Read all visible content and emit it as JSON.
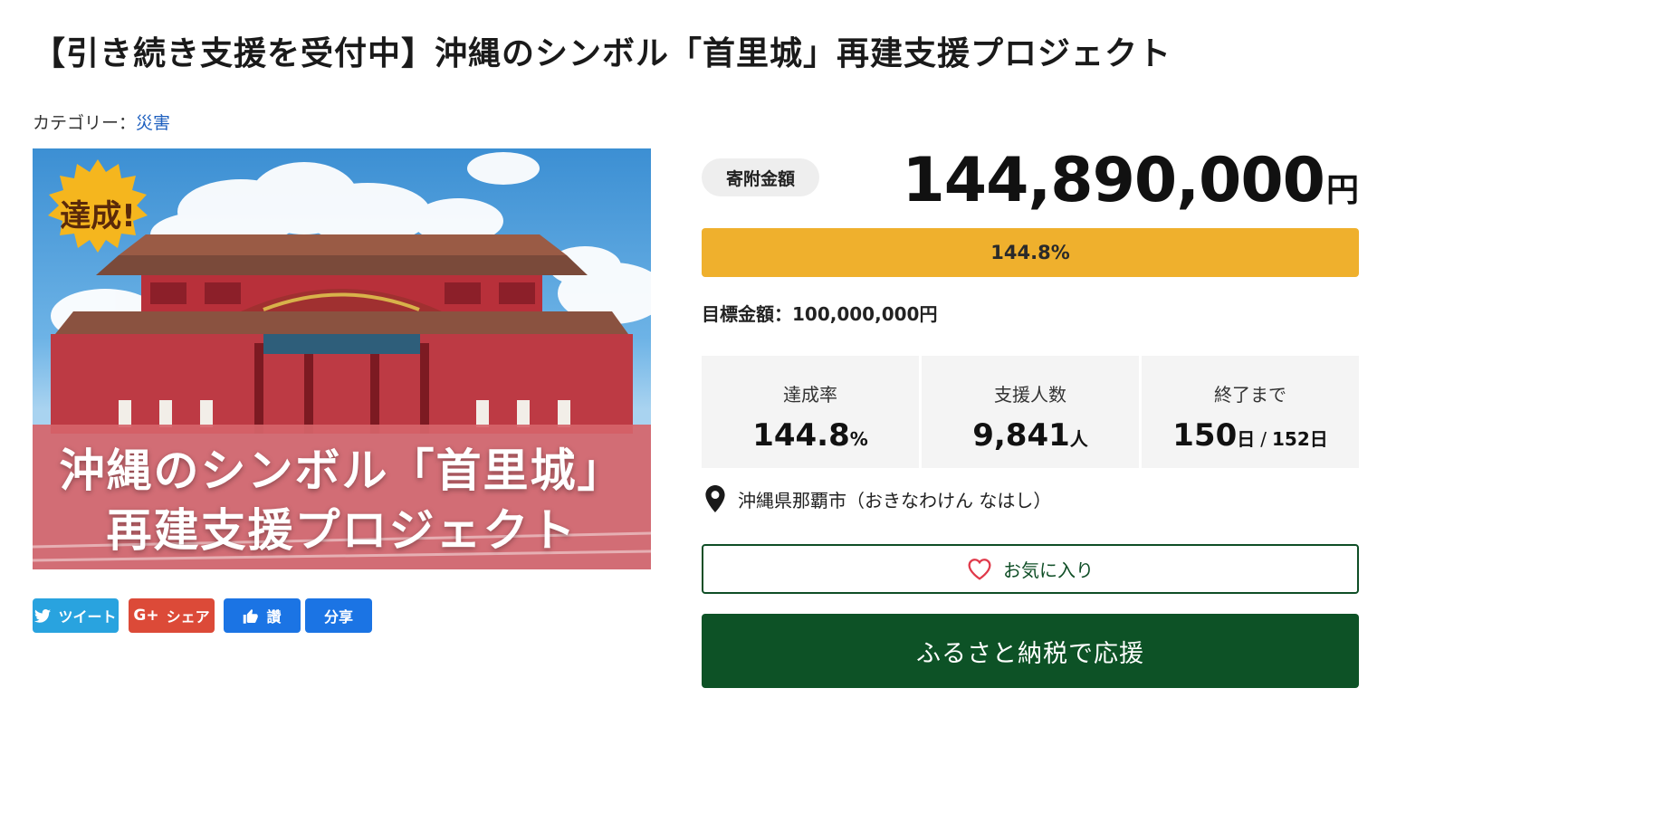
{
  "page": {
    "title": "【引き続き支援を受付中】沖縄のシンボル「首里城」再建支援プロジェクト",
    "category_prefix": "カテゴリー：",
    "category_link": "災害"
  },
  "hero": {
    "badge": "達成!",
    "caption_line1": "沖縄のシンボル「首里城」",
    "caption_line2": "再建支援プロジェクト"
  },
  "share": {
    "twitter": "ツイート",
    "gplus_prefix": "G+",
    "gplus": "シェア",
    "like": "讚",
    "fb_share": "分享"
  },
  "donation": {
    "pill_label": "寄附金額",
    "amount": "144,890,000",
    "amount_unit": "円",
    "progress_percent": 144.8,
    "progress_label": "144.8%",
    "goal_label": "目標金額：100,000,000円"
  },
  "stats": {
    "rate": {
      "label": "達成率",
      "value": "144.8",
      "unit": "%"
    },
    "supporters": {
      "label": "支援人数",
      "value": "9,841",
      "unit": "人"
    },
    "remaining": {
      "label": "終了まで",
      "value": "150",
      "unit": "日",
      "separator": "/",
      "total": "152日"
    }
  },
  "location": {
    "icon": "map-pin-icon",
    "text": "沖縄県那覇市（おきなわけん なはし）"
  },
  "actions": {
    "favorite_icon": "heart-icon",
    "favorite_label": "お気に入り",
    "donate_label": "ふるさと納税で応援"
  },
  "colors": {
    "progress": "#efb02d",
    "primary_green": "#0d5226",
    "link": "#1d5fbf",
    "twitter": "#29a3df",
    "gplus": "#dc4a38",
    "facebook": "#1b74e4",
    "heart": "#e0394a"
  }
}
